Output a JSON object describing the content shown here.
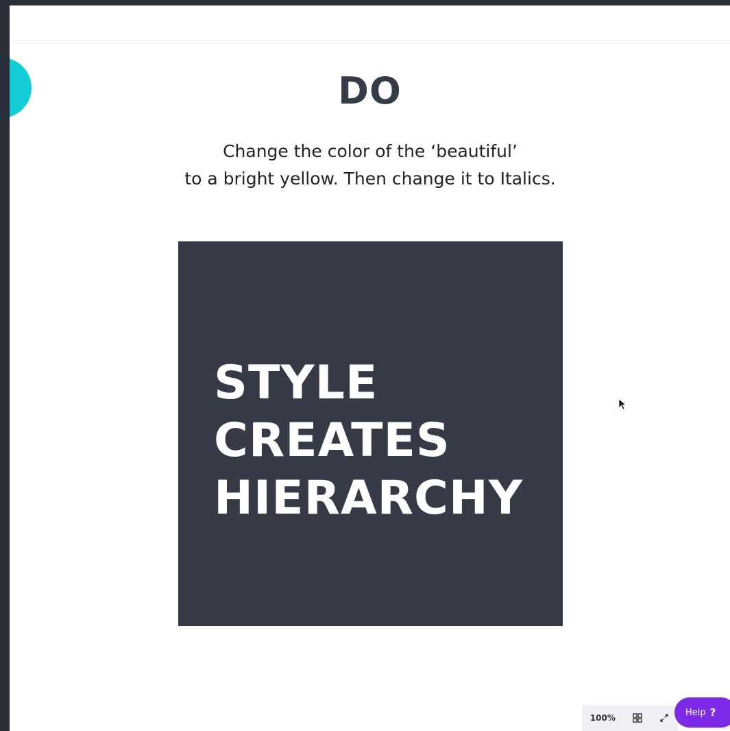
{
  "slide": {
    "title": "DO",
    "instructions": [
      "Change the color of the ‘beautiful’",
      "to a bright yellow. Then change it to Italics."
    ],
    "card_lines": [
      "STYLE",
      "CREATES",
      "HIERARCHY"
    ]
  },
  "toolbar": {
    "zoom": "100%",
    "grid_icon": "grid-view-icon",
    "fullscreen_icon": "fullscreen-icon"
  },
  "help": {
    "label": "Help",
    "icon": "?"
  },
  "colors": {
    "accent_circle": "#14cbd8",
    "card_background": "#363a46",
    "title": "#363b4a",
    "help_button": "#7d2ae8"
  }
}
